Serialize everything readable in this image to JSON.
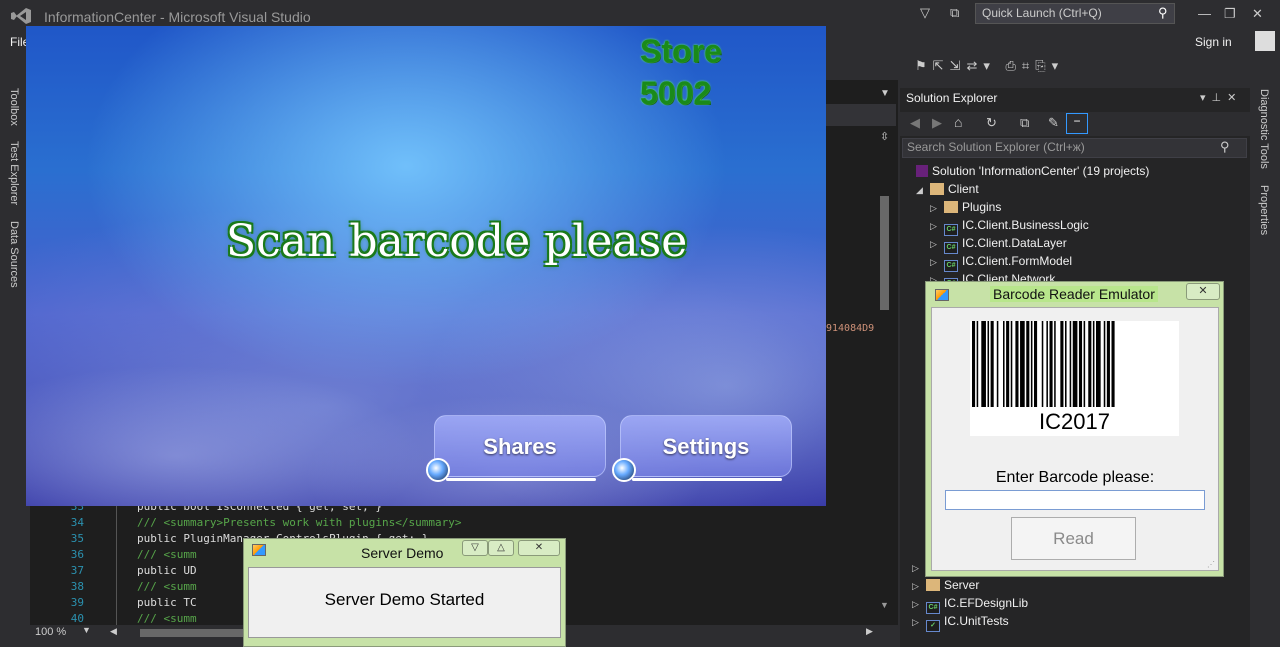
{
  "vs": {
    "title": "InformationCenter - Microsoft Visual Studio",
    "quick_launch": "Quick Launch (Ctrl+Q)",
    "menu_file": "File",
    "sign_in": "Sign in",
    "left_tabs": [
      "Toolbox",
      "Test Explorer",
      "Data Sources"
    ],
    "right_tabs": [
      "Diagnostic Tools",
      "Properties"
    ],
    "zoom": "100 %",
    "overflow_text": "914084D9"
  },
  "code": {
    "lines": [
      {
        "num": "33",
        "text": "        public bool IsConnected { get; set; }"
      },
      {
        "num": "34",
        "text": "        /// <summary>Presents work with plugins</summary>"
      },
      {
        "num": "35",
        "text": "        public PluginManager ControlsPlugin { get; }"
      },
      {
        "num": "36",
        "text": "        /// <summ"
      },
      {
        "num": "37",
        "text": "        public UD"
      },
      {
        "num": "38",
        "text": "        /// <summ"
      },
      {
        "num": "39",
        "text": "        public TC"
      },
      {
        "num": "40",
        "text": "        /// <summ"
      }
    ]
  },
  "solution_explorer": {
    "title": "Solution Explorer",
    "search_placeholder": "Search Solution Explorer (Ctrl+ж)",
    "solution": "Solution 'InformationCenter' (19 projects)",
    "items": [
      {
        "label": "Client",
        "icon": "folder-icon",
        "arrow": "◢"
      },
      {
        "label": "Plugins",
        "icon": "folder-icon",
        "arrow": "▷"
      },
      {
        "label": "IC.Client.BusinessLogic",
        "icon": "csharp-project-icon",
        "arrow": "▷"
      },
      {
        "label": "IC.Client.DataLayer",
        "icon": "csharp-project-icon",
        "arrow": "▷"
      },
      {
        "label": "IC.Client.FormModel",
        "icon": "csharp-project-icon",
        "arrow": "▷"
      },
      {
        "label": "IC.Client.Network",
        "icon": "csharp-project-icon",
        "arrow": "▷"
      }
    ],
    "bottom_items": [
      {
        "label": "",
        "icon": "",
        "arrow": "▷"
      },
      {
        "label": "Server",
        "icon": "folder-icon",
        "arrow": "▷"
      },
      {
        "label": "IC.EFDesignLib",
        "icon": "csharp-project-icon",
        "arrow": "▷"
      },
      {
        "label": "IC.UnitTests",
        "icon": "test-project-icon",
        "arrow": "▷"
      }
    ]
  },
  "app": {
    "store_line1": "Store",
    "store_line2": "5002",
    "headline": "Scan barcode please",
    "shares_label": "Shares",
    "settings_label": "Settings"
  },
  "barcode_emulator": {
    "title": "Barcode Reader Emulator",
    "barcode_text": "IC2017",
    "prompt": "Enter Barcode please:",
    "input_value": "",
    "read_label": "Read"
  },
  "server_demo": {
    "title": "Server Demo",
    "message": "Server Demo Started"
  },
  "colors": {
    "vs_bg": "#2d2d30",
    "editor_bg": "#1e1e1e",
    "form_chrome": "#c7e2a7",
    "headline_outline": "#1a7a1a"
  }
}
